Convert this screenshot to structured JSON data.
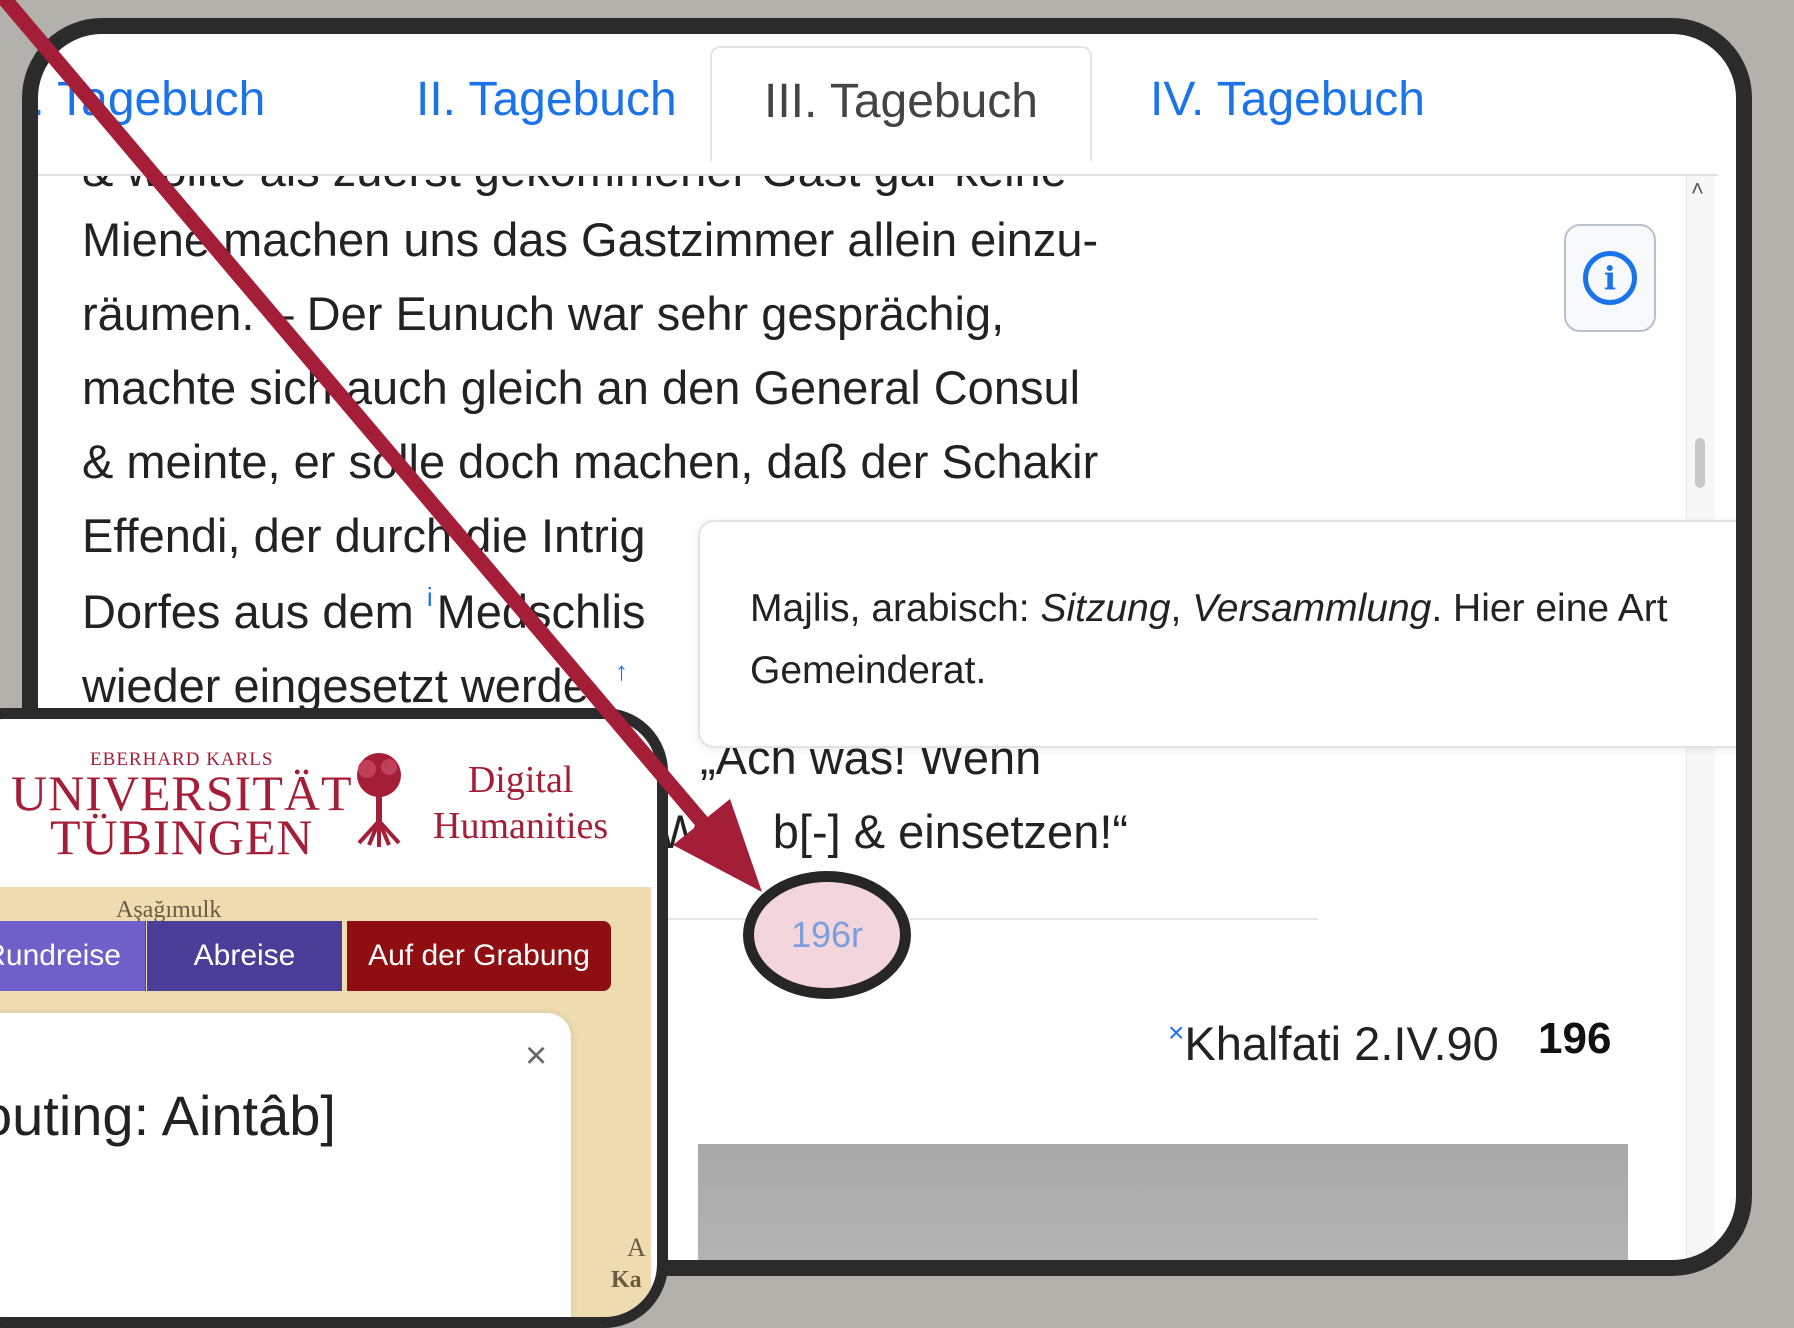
{
  "tabs": [
    {
      "label": "I. Tagebuch"
    },
    {
      "label": "II. Tagebuch"
    },
    {
      "label": "III. Tagebuch"
    },
    {
      "label": "IV. Tagebuch"
    }
  ],
  "text": {
    "lines": [
      "& wollte als zuerst gekommener Gast gar keine",
      "Miene machen uns das Gastzimmer allein einzu-",
      "räumen. – Der Eunuch war sehr gesprächig,",
      "machte sich auch gleich an den General Consul",
      "& meinte, er solle doch machen, daß der Schakir",
      "Effendi, der durch die Intrig",
      "Dorfes aus dem ",
      "wieder eingesetzt werde. ",
      "„Ach was! Wenn",
      "b[-] & einsetzen!“"
    ],
    "marker_i": "i",
    "line7_word": "Medschlis",
    "marker_up": "↑",
    "partial_wa": "Wa"
  },
  "info_icon": "info-icon",
  "popover": {
    "text_before": "Majlis, arabisch: ",
    "em1": "Sitzung",
    "comma": ", ",
    "em2": "Versammlung",
    "text_after": ". Hier eine Art Gemeinderat."
  },
  "page_badge": "196r",
  "page_head": {
    "marker": "×",
    "text": "Khalfati 2.IV.90",
    "number": "196"
  },
  "mini": {
    "logo_small": "EBERHARD KARLS",
    "logo_line1": "UNIVERSITÄT",
    "logo_line2": "TÜBINGEN",
    "dh_line1": "Digital",
    "dh_line2": "Humanities",
    "buttons": [
      "Rundreise",
      "Abreise",
      "Auf der Grabung"
    ],
    "popup_close": "×",
    "popup_title": "[Routing: Aintâb]",
    "map_labels": [
      "Aşağımulk",
      "A",
      "Ka"
    ]
  },
  "colors": {
    "link": "#1a73e8",
    "arrow": "#a51e37",
    "frame": "#2b2b2b",
    "badge_bg": "#f3d6dc",
    "btn_rund": "#6f5fc8",
    "btn_abreise": "#4a3e98",
    "btn_grabung": "#8e0e12"
  }
}
